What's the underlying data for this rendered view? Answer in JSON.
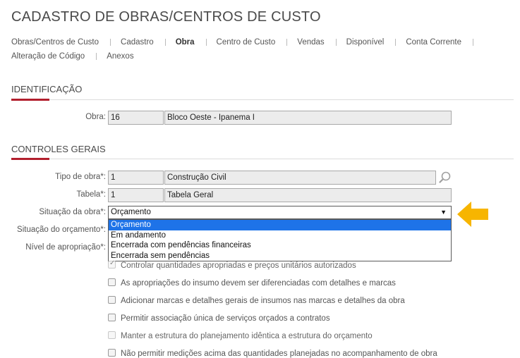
{
  "title": "CADASTRO DE OBRAS/CENTROS DE CUSTO",
  "tabs": [
    {
      "label": "Obras/Centros de Custo"
    },
    {
      "label": "Cadastro"
    },
    {
      "label": "Obra",
      "active": true
    },
    {
      "label": "Centro de Custo"
    },
    {
      "label": "Vendas"
    },
    {
      "label": "Disponível"
    },
    {
      "label": "Conta Corrente"
    },
    {
      "label": "Alteração de Código"
    },
    {
      "label": "Anexos"
    }
  ],
  "identificacao": {
    "section_title": "IDENTIFICAÇÃO",
    "obra_label": "Obra:",
    "obra_code": "16",
    "obra_name": "Bloco Oeste - Ipanema I"
  },
  "controles": {
    "section_title": "CONTROLES GERAIS",
    "tipo_label": "Tipo de obra*:",
    "tipo_code": "1",
    "tipo_name": "Construção Civil",
    "tabela_label": "Tabela*:",
    "tabela_code": "1",
    "tabela_name": "Tabela Geral",
    "situacao_label": "Situação da obra*:",
    "situacao_value": "Orçamento",
    "situacao_options": [
      "Orçamento",
      "Em andamento",
      "Encerrada com pendências financeiras",
      "Encerrada sem pendências"
    ],
    "situacao_orc_label": "Situação do orçamento*:",
    "nivel_label": "Nível de apropriação*:",
    "checkboxes": [
      {
        "label": "Controlar quantidades apropriadas e preços unitários autorizados",
        "checked": true,
        "disabled": true
      },
      {
        "label": "As apropriações do insumo devem ser diferenciadas com detalhes e marcas",
        "checked": false,
        "disabled": false
      },
      {
        "label": "Adicionar marcas e detalhes gerais de insumos nas marcas e detalhes da obra",
        "checked": false,
        "disabled": false
      },
      {
        "label": "Permitir associação única de serviços orçados a contratos",
        "checked": false,
        "disabled": false
      },
      {
        "label": "Manter a estrutura do planejamento idêntica a estrutura do orçamento",
        "checked": false,
        "disabled": true
      },
      {
        "label": "Não permitir medições acima das quantidades planejadas no acompanhamento de obra",
        "checked": false,
        "disabled": false
      }
    ]
  },
  "colors": {
    "accent": "#b21f2d",
    "highlight": "#1e73e8",
    "callout": "#f7b500"
  },
  "icons": {
    "lookup": "search-icon",
    "callout": "arrow-left-icon"
  }
}
